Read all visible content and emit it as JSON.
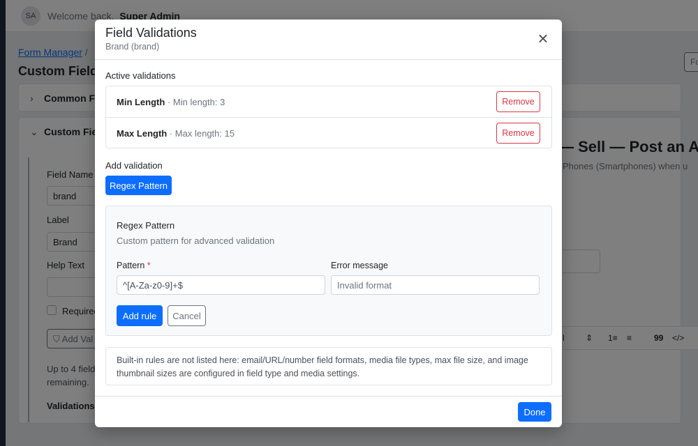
{
  "background": {
    "user": {
      "initials": "SA",
      "welcome": "Welcome back,",
      "name": "Super Admin"
    },
    "breadcrumb": {
      "link": "Form Manager",
      "sep": "/"
    },
    "page_title": "Custom Field",
    "top_button": "Fo",
    "accordion": [
      {
        "label": "Common F",
        "icon": "chevron-right-icon"
      },
      {
        "label": "Custom Fie",
        "icon": "chevron-down-icon"
      }
    ],
    "left_form": {
      "field_name_label": "Field Name",
      "field_name_value": "brand",
      "label_label": "Label",
      "label_value": "Brand",
      "help_text_label": "Help Text",
      "required_label": "Required",
      "add_val_button": "Add Val",
      "help_line1": "Up to 4 field",
      "help_line2": "remaining.",
      "validations_label": "Validations:"
    },
    "preview": {
      "title": "— Sell — Post an Ad",
      "subtitle": "Phones (Smartphones) when u",
      "toolbar": [
        "l",
        "⇕",
        "1≡",
        "≡",
        "99",
        "</>"
      ]
    }
  },
  "modal": {
    "title": "Field Validations",
    "subtitle": "Brand (brand)",
    "active_label": "Active validations",
    "active": [
      {
        "name": "Min Length",
        "desc": "· Min length: 3",
        "remove_label": "Remove"
      },
      {
        "name": "Max Length",
        "desc": "· Max length: 15",
        "remove_label": "Remove"
      }
    ],
    "add_label": "Add validation",
    "type_button": "Regex Pattern",
    "rule_card": {
      "title": "Regex Pattern",
      "description": "Custom pattern for advanced validation",
      "pattern_label": "Pattern",
      "required_mark": "*",
      "pattern_value": "^[A-Za-z0-9]+$",
      "error_label": "Error message",
      "error_placeholder": "Invalid format",
      "add_rule": "Add rule",
      "cancel": "Cancel"
    },
    "note": "Built-in rules are not listed here: email/URL/number field formats, media file types, max file size, and image thumbnail sizes are configured in field type and media settings.",
    "done": "Done"
  },
  "colors": {
    "primary": "#0d6efd",
    "danger": "#dc3545",
    "sidebar": "#232a3b",
    "overlay": "rgba(0,0,0,0.5)"
  }
}
